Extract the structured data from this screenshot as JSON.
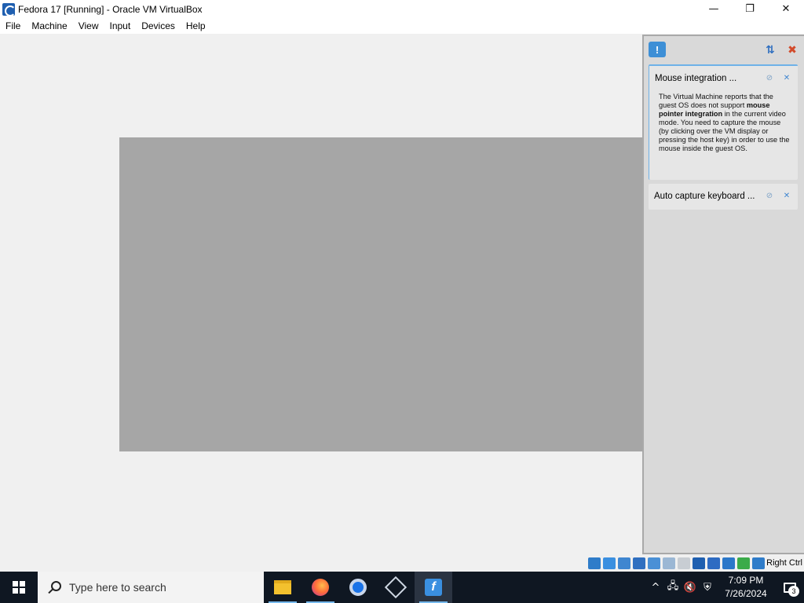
{
  "window": {
    "title": "Fedora 17 [Running] - Oracle VM VirtualBox",
    "controls": {
      "minimize": "—",
      "restore": "❐",
      "close": "✕"
    }
  },
  "menu": [
    "File",
    "Machine",
    "View",
    "Input",
    "Devices",
    "Help"
  ],
  "notification_panel": {
    "toggle_icon": "notification-center-icon",
    "cards": [
      {
        "title": "Mouse integration ...",
        "body_parts": [
          {
            "text": "The Virtual Machine reports that the guest OS does not support ",
            "bold": false
          },
          {
            "text": "mouse pointer integration",
            "bold": true
          },
          {
            "text": " in the current video mode. You need to capture the mouse (by clicking over the VM display or pressing the host key) in order to use the mouse inside the guest OS.",
            "bold": false
          }
        ]
      },
      {
        "title": "Auto capture keyboard ..."
      }
    ]
  },
  "statusbar": {
    "host_key": "Right Ctrl",
    "icons": [
      {
        "name": "hard-disk-icon",
        "color": "#2f7cc9"
      },
      {
        "name": "optical-drive-icon",
        "color": "#3a8fe0"
      },
      {
        "name": "audio-icon",
        "color": "#3f86d0"
      },
      {
        "name": "network-icon",
        "color": "#2f6fc0"
      },
      {
        "name": "usb-icon",
        "color": "#4a90d6"
      },
      {
        "name": "shared-folders-icon",
        "color": "#9bb7d4"
      },
      {
        "name": "display-icon",
        "color": "#c8cdd3"
      },
      {
        "name": "video-capture-icon",
        "color": "#1f5fb0"
      },
      {
        "name": "vt-x-icon",
        "color": "#2e6bc2"
      },
      {
        "name": "cpu-icon",
        "color": "#2c78c9"
      },
      {
        "name": "mouse-integration-icon",
        "color": "#3bab4a"
      },
      {
        "name": "keyboard-capture-icon",
        "color": "#2f7cc9"
      }
    ]
  },
  "taskbar": {
    "search_placeholder": "Type here to search",
    "clock_time": "7:09 PM",
    "clock_date": "7/26/2024",
    "notification_count": "3"
  }
}
